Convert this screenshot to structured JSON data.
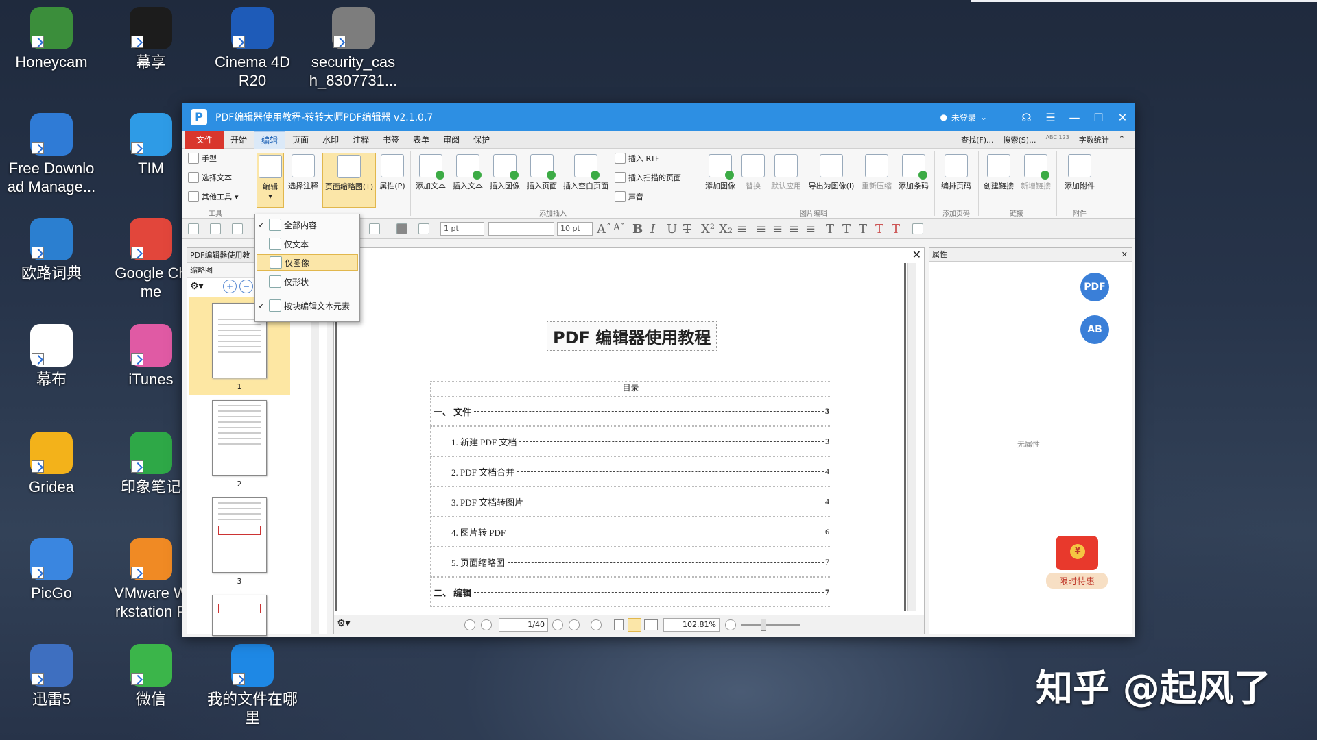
{
  "desktop": {
    "icons": [
      {
        "label": "Honeycam",
        "color": "#3b8e3b"
      },
      {
        "label": "幕享",
        "color": "#1c1c1c"
      },
      {
        "label": "Cinema 4D R20",
        "color": "#1e5bb8"
      },
      {
        "label": "security_cas h_8307731...",
        "color": "#7d7d7d"
      },
      {
        "label": "Free Downlo ad Manage...",
        "color": "#2f7bd6"
      },
      {
        "label": "TIM",
        "color": "#2e9be6"
      },
      {
        "label": "欧路词典",
        "color": "#2b7fd0"
      },
      {
        "label": "Google Ch me",
        "color": "#e2463b"
      },
      {
        "label": "幕布",
        "color": "#ffffff"
      },
      {
        "label": "iTunes",
        "color": "#e05aa4"
      },
      {
        "label": "Gridea",
        "color": "#f3b21a"
      },
      {
        "label": "印象笔记",
        "color": "#2ea847"
      },
      {
        "label": "PicGo",
        "color": "#3a86e0"
      },
      {
        "label": "VMware W rkstation P",
        "color": "#f08a24"
      },
      {
        "label": "迅雷5",
        "color": "#3e6fc0"
      },
      {
        "label": "微信",
        "color": "#3bb54a"
      },
      {
        "label": "我的文件在哪 里",
        "color": "#1e88e5"
      }
    ],
    "watermark": "知乎 @起风了"
  },
  "window": {
    "title": "PDF编辑器使用教程-转转大师PDF编辑器 v2.1.0.7",
    "account": "未登录",
    "controls": {
      "menu": "☰",
      "minimize": "—",
      "maximize": "☐",
      "close": "✕"
    }
  },
  "menubar": {
    "items": [
      "文件",
      "开始",
      "编辑",
      "页面",
      "水印",
      "注释",
      "书签",
      "表单",
      "审阅",
      "保护"
    ],
    "active": "编辑",
    "find": "查找(F)...",
    "search": "搜索(S)...",
    "wordcount": "字数统计",
    "abc": "ABC 123"
  },
  "ribbon": {
    "tools": {
      "hand": "手型",
      "select_text": "选择文本",
      "other_tools": "其他工具",
      "group": "工具"
    },
    "edit": "编辑",
    "select_annot": "选择注释",
    "page_thumb": "页面缩略图(T)",
    "properties": "属性(P)",
    "insert_group": {
      "add_text": "添加文本",
      "insert_text": "插入文本",
      "insert_image": "插入图像",
      "insert_page": "插入页面",
      "insert_blank": "插入空白页面",
      "insert_rtf": "插入 RTF",
      "insert_scan": "插入扫描的页面",
      "sound": "声音",
      "group": "添加插入"
    },
    "image_group": {
      "add_image": "添加图像",
      "replace": "替换",
      "default_apply": "默认应用",
      "export_image": "导出为图像(I)",
      "recompress": "重新压缩",
      "add_barcode": "添加条码",
      "group": "图片编辑"
    },
    "page_number_group": {
      "bates": "编排页码",
      "group": "添加页码"
    },
    "link_group": {
      "create": "创建链接",
      "new": "新增链接",
      "group": "链接"
    },
    "attach_group": {
      "add": "添加附件",
      "group": "附件"
    }
  },
  "format_bar": {
    "line_width": "1 pt",
    "font_name": "",
    "font_size": "10 pt"
  },
  "dropdown": {
    "items": [
      {
        "label": "全部内容",
        "checked": true
      },
      {
        "label": "仅文本",
        "checked": false
      },
      {
        "label": "仅图像",
        "checked": false,
        "selected": true
      },
      {
        "label": "仅形状",
        "checked": false
      },
      {
        "label": "按块编辑文本元素",
        "checked": true
      }
    ]
  },
  "left_panel": {
    "tab": "PDF编辑器使用教",
    "header": "缩略图",
    "pages": [
      "1",
      "2",
      "3"
    ]
  },
  "document": {
    "title": "PDF 编辑器使用教程",
    "toc_heading": "目录",
    "toc": [
      {
        "text": "一、 文件",
        "page": "3",
        "level": 1
      },
      {
        "text": "1. 新建 PDF 文档",
        "page": "3",
        "level": 2
      },
      {
        "text": "2. PDF 文档合并",
        "page": "4",
        "level": 2
      },
      {
        "text": "3. PDF 文档转图片",
        "page": "4",
        "level": 2
      },
      {
        "text": "4. 图片转 PDF",
        "page": "6",
        "level": 2
      },
      {
        "text": "5. 页面缩略图",
        "page": "7",
        "level": 2
      },
      {
        "text": "二、 编辑",
        "page": "7",
        "level": 1
      }
    ],
    "page_indicator": "1/40",
    "zoom": "102.81%"
  },
  "right_panel": {
    "header": "属性",
    "empty_text": "无属性",
    "btn1": "PDF",
    "btn2": "AB",
    "promo": "限时特惠"
  }
}
